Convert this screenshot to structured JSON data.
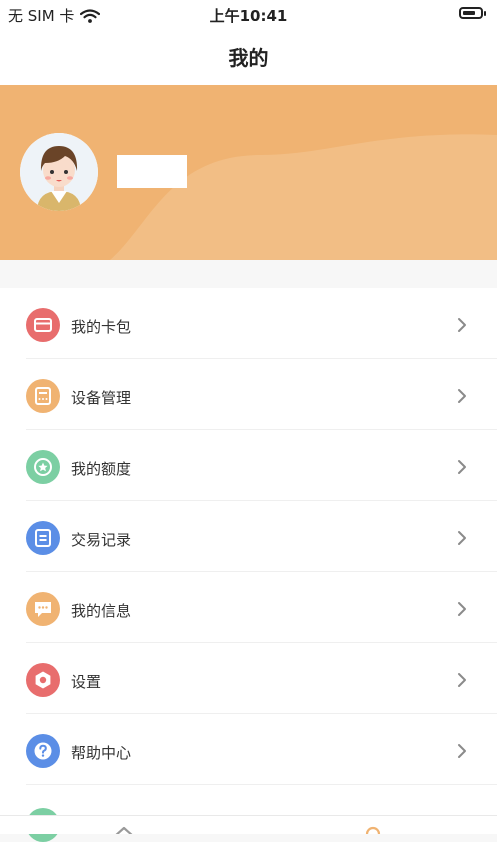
{
  "status_bar": {
    "carrier": "无 SIM 卡",
    "time": "上午10:41"
  },
  "nav": {
    "title": "我的"
  },
  "colors": {
    "header": "#f0b372",
    "accent": "#f0b372"
  },
  "menu": {
    "items": [
      {
        "label": "我的卡包",
        "icon": "card-icon",
        "color": "#e86d6d"
      },
      {
        "label": "设备管理",
        "icon": "device-icon",
        "color": "#f0b372"
      },
      {
        "label": "我的额度",
        "icon": "star-icon",
        "color": "#7ccfa3"
      },
      {
        "label": "交易记录",
        "icon": "record-icon",
        "color": "#5b8ee6"
      },
      {
        "label": "我的信息",
        "icon": "message-icon",
        "color": "#f0b372"
      },
      {
        "label": "设置",
        "icon": "settings-icon",
        "color": "#e86d6d"
      },
      {
        "label": "帮助中心",
        "icon": "help-icon",
        "color": "#5b8ee6"
      }
    ]
  },
  "tab_bar": {
    "items": [
      {
        "icon": "home-icon",
        "color": "#999999"
      },
      {
        "icon": "profile-icon",
        "color": "#f0b372"
      }
    ]
  }
}
